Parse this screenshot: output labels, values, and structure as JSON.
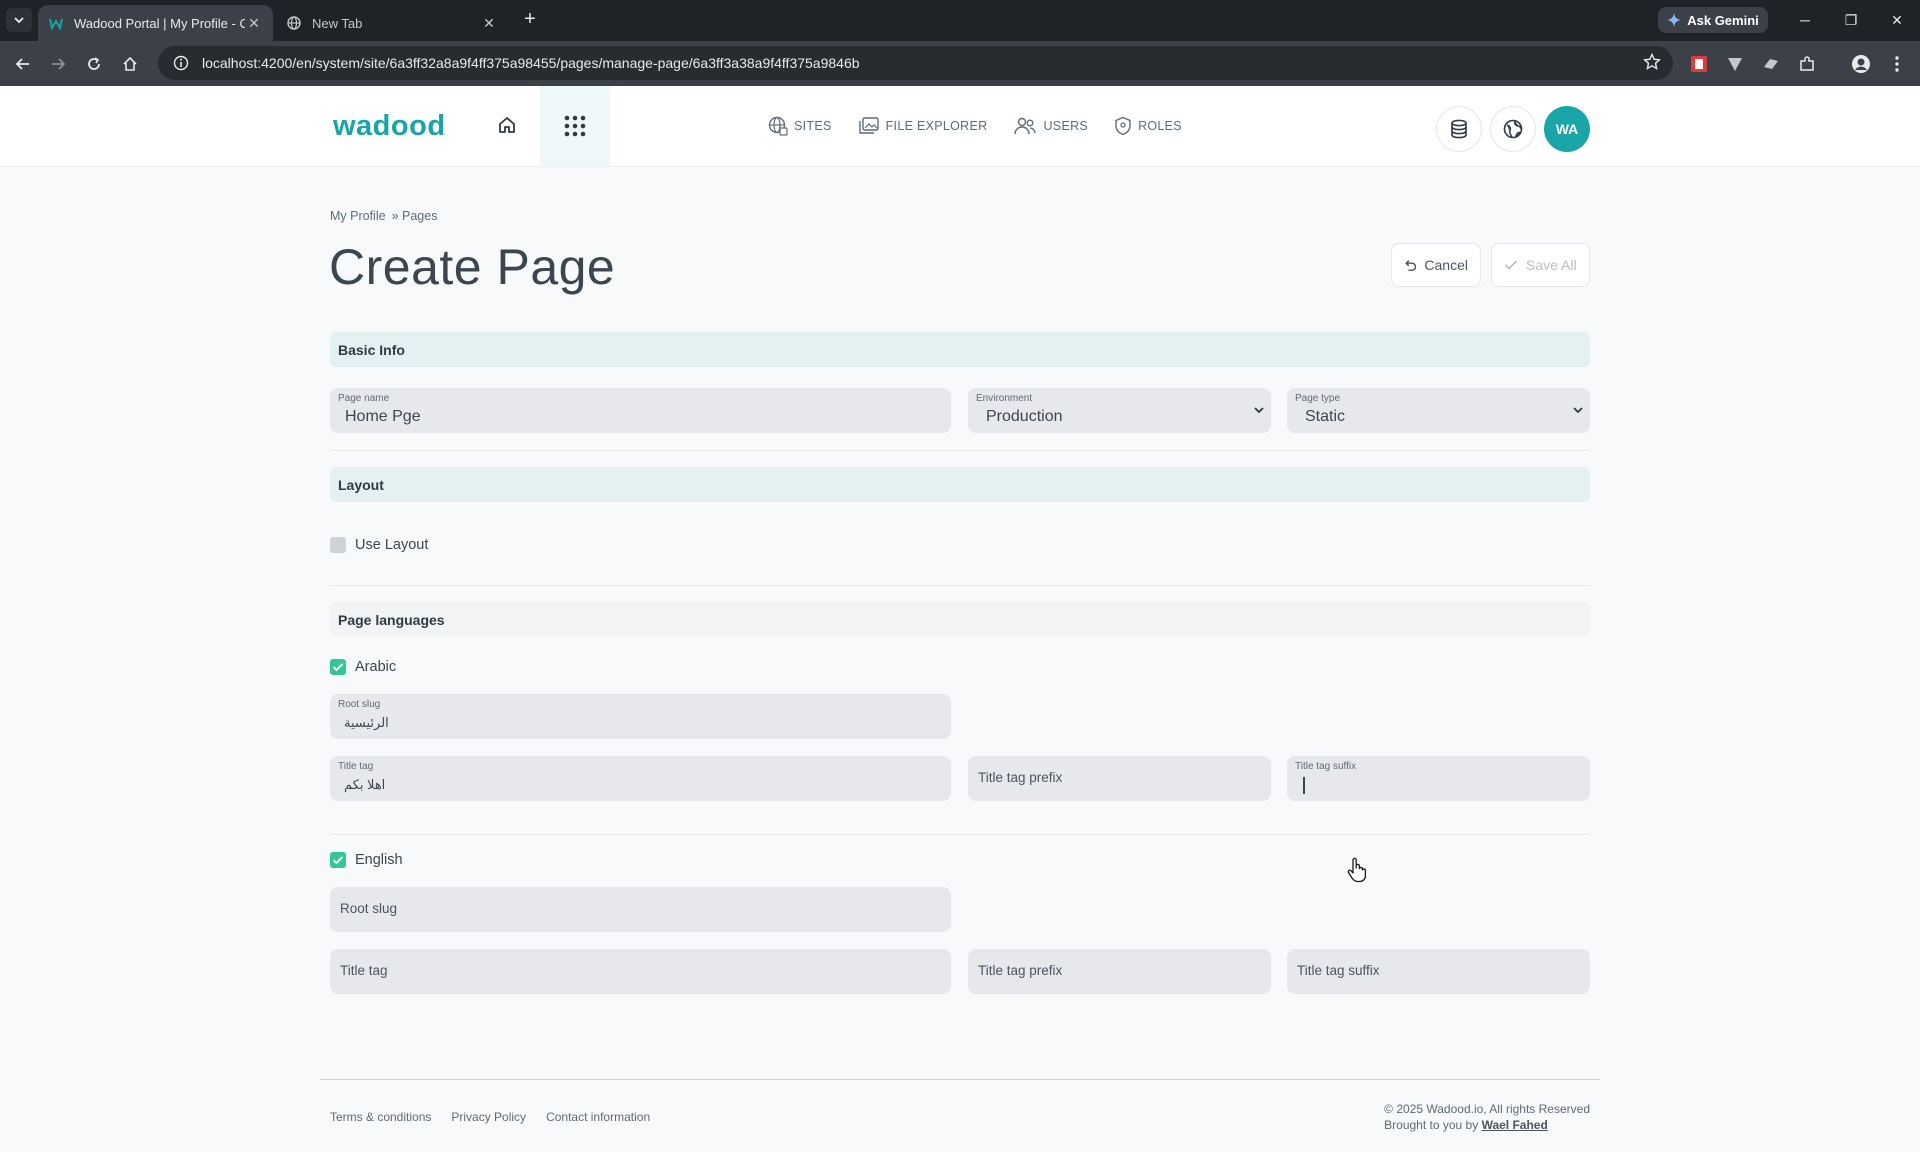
{
  "browser": {
    "tabs": [
      {
        "title": "Wadood Portal | My Profile - Cr"
      },
      {
        "title": "New Tab"
      }
    ],
    "new_tab_symbol": "+",
    "ask_gemini": "Ask Gemini",
    "url": "localhost:4200/en/system/site/6a3ff32a8a9f4ff375a98455/pages/manage-page/6a3ff3a38a9f4ff375a9846b"
  },
  "header": {
    "logo": "wadood",
    "nav": [
      {
        "label": "SITES",
        "icon": "globe-grid-icon"
      },
      {
        "label": "FILE EXPLORER",
        "icon": "images-icon"
      },
      {
        "label": "USERS",
        "icon": "users-icon"
      },
      {
        "label": "ROLES",
        "icon": "shield-icon"
      }
    ],
    "avatar_initials": "WA"
  },
  "breadcrumb": {
    "items": [
      "My Profile",
      "» Pages"
    ]
  },
  "page": {
    "title": "Create Page",
    "cancel_label": "Cancel",
    "save_label": "Save All"
  },
  "basic_info": {
    "title": "Basic Info",
    "page_name": {
      "label": "Page name",
      "value": "Home Pge"
    },
    "environment": {
      "label": "Environment",
      "value": "Production"
    },
    "page_type": {
      "label": "Page type",
      "value": "Static"
    }
  },
  "layout": {
    "title": "Layout",
    "use_layout_label": "Use Layout",
    "use_layout_checked": false
  },
  "languages": {
    "title": "Page languages",
    "arabic": {
      "label": "Arabic",
      "checked": true,
      "root_slug_label": "Root slug",
      "root_slug_value": "الرئيسية",
      "title_tag_label": "Title tag",
      "title_tag_value": "اهلا بكم",
      "title_tag_prefix_placeholder": "Title tag prefix",
      "title_tag_suffix_label": "Title tag suffix"
    },
    "english": {
      "label": "English",
      "checked": true,
      "root_slug_placeholder": "Root slug",
      "title_tag_placeholder": "Title tag",
      "title_tag_prefix_placeholder": "Title tag prefix",
      "title_tag_suffix_placeholder": "Title tag suffix"
    }
  },
  "footer": {
    "links": [
      "Terms & conditions",
      "Privacy Policy",
      "Contact information"
    ],
    "copyright": "© 2025 Wadood.io, All rights Reserved",
    "brought_by": "Brought to you by",
    "author": "Wael Fahed"
  },
  "colors": {
    "accent": "#19a6a8",
    "check_green": "#2ec995",
    "section_teal": "#e3f1f2"
  }
}
